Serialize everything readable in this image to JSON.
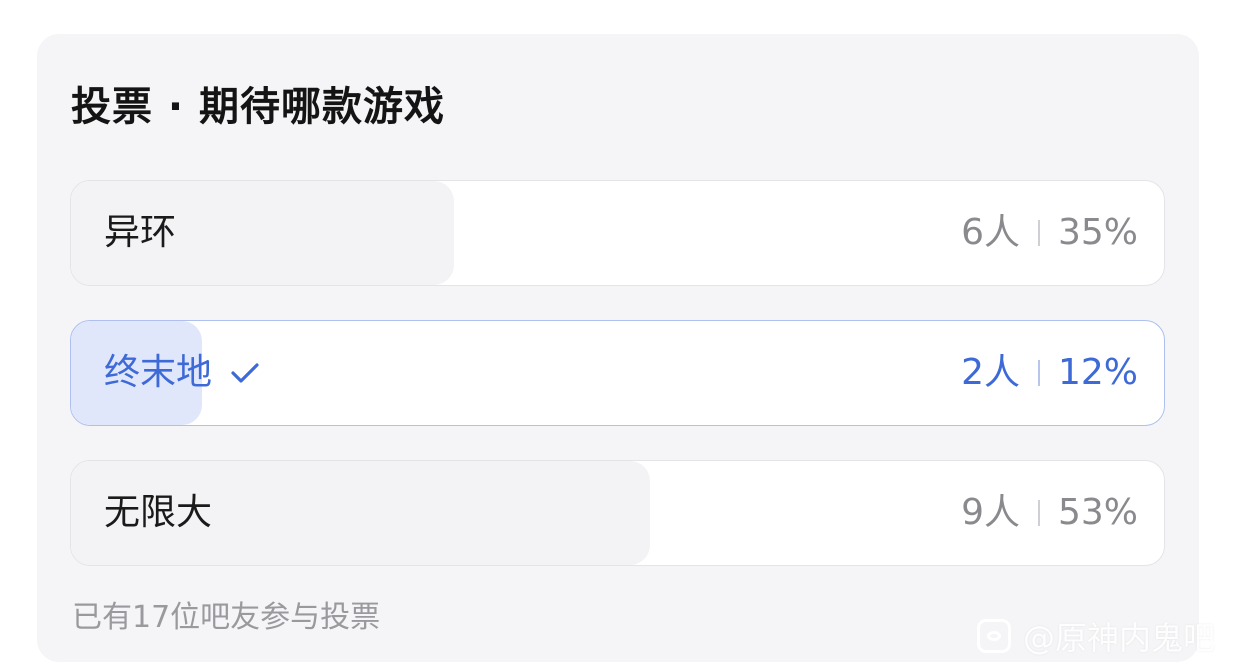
{
  "poll": {
    "title": "投票 · 期待哪款游戏",
    "options": [
      {
        "label": "异环",
        "count": "6人",
        "percent": "35%",
        "fraction": 0.35,
        "selected": false
      },
      {
        "label": "终末地",
        "count": "2人",
        "percent": "12%",
        "fraction": 0.12,
        "selected": true
      },
      {
        "label": "无限大",
        "count": "9人",
        "percent": "53%",
        "fraction": 0.53,
        "selected": false
      }
    ],
    "footer": "已有17位吧友参与投票"
  },
  "watermark": {
    "text": "@原神内鬼吧",
    "icon": "chat-bubble-icon"
  },
  "colors": {
    "accent": "#3d6ad6",
    "selected_fill": "#e1e7fb",
    "unselected_fill": "#f3f3f5",
    "card_bg": "#f5f5f7"
  }
}
